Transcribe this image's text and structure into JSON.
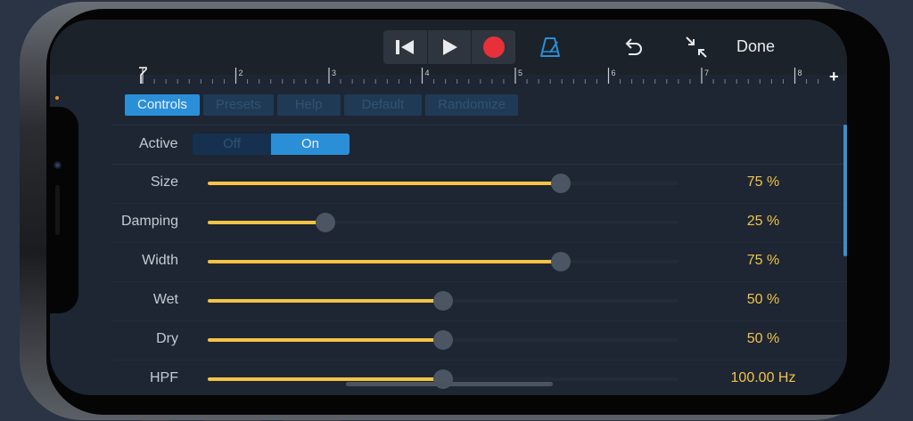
{
  "toolbar": {
    "done_label": "Done"
  },
  "ruler": {
    "marks": [
      "2",
      "3",
      "4",
      "5",
      "6",
      "7",
      "8"
    ],
    "add_label": "+"
  },
  "tabs": [
    "Controls",
    "Presets",
    "Help",
    "Default",
    "Randomize"
  ],
  "active_toggle": {
    "label": "Active",
    "off_label": "Off",
    "on_label": "On",
    "selected": "On"
  },
  "parameters": [
    {
      "label": "Size",
      "value_text": "75 %",
      "level": 0.75
    },
    {
      "label": "Damping",
      "value_text": "25 %",
      "level": 0.25
    },
    {
      "label": "Width",
      "value_text": "75 %",
      "level": 0.75
    },
    {
      "label": "Wet",
      "value_text": "50 %",
      "level": 0.5
    },
    {
      "label": "Dry",
      "value_text": "50 %",
      "level": 0.5
    },
    {
      "label": "HPF",
      "value_text": "100.00 Hz",
      "level": 0.5
    }
  ],
  "colors": {
    "accent_blue": "#2b8fd8",
    "slider_fill": "#f6c344",
    "value_text": "#f2c24a",
    "record_red": "#e8303a"
  }
}
